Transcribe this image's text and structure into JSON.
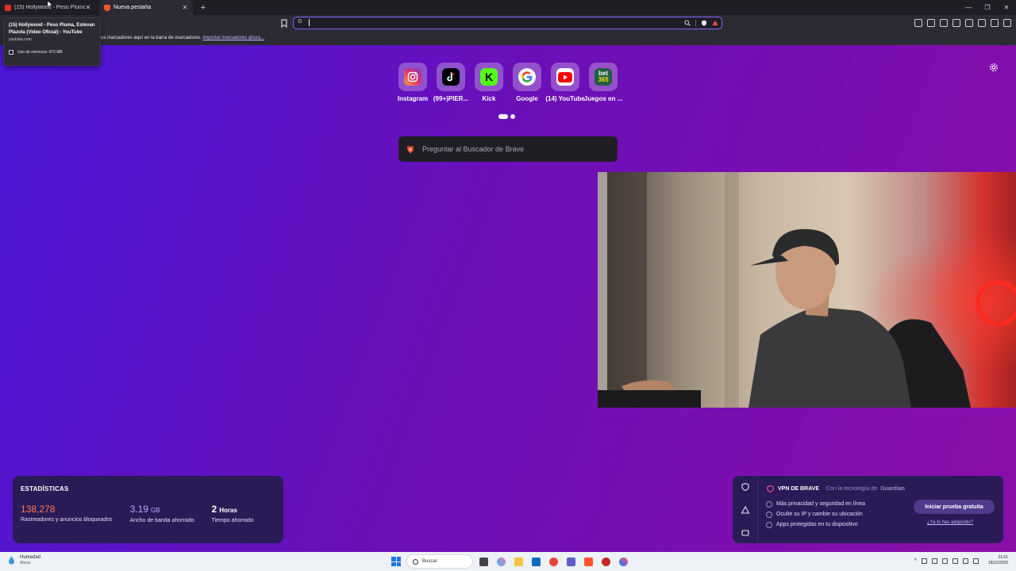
{
  "tabs": [
    {
      "title": "(15) Hollywood - Peso Pluma, Es",
      "favicon": "youtube-icon",
      "active": false
    },
    {
      "title": "Nueva pestaña",
      "favicon": "brave-icon",
      "active": true
    }
  ],
  "tooltip": {
    "title": "(15) Hollywood - Peso Pluma, Estevan Plazola (Video Oficial) - YouTube",
    "domain": "youtube.com",
    "memory": "Uso de memoria: 473 MB"
  },
  "address_bar": {
    "value": "",
    "engine_icon": "google-icon"
  },
  "bookmarks_bar": {
    "text": "us marcadores aquí en la barra de marcadores.",
    "link": "Importar marcadores ahora..."
  },
  "top_sites": [
    {
      "label": "Instagram",
      "icon": "instagram-icon",
      "color": "#e1306c"
    },
    {
      "label": "(99+)PIER...",
      "icon": "tiktok-icon",
      "color": "#000000"
    },
    {
      "label": "Kick",
      "icon": "kick-icon",
      "color": "#53fc18"
    },
    {
      "label": "Google",
      "icon": "google-icon",
      "color": "#ffffff"
    },
    {
      "label": "(14) YouTube",
      "icon": "youtube-icon",
      "color": "#ff0000"
    },
    {
      "label": "Juegos en ...",
      "icon": "bet365-icon",
      "color": "#1f5f3f"
    }
  ],
  "search": {
    "placeholder": "Preguntar al Buscador de Brave"
  },
  "stats": {
    "title": "ESTADÍSTICAS",
    "items": [
      {
        "value": "138,278",
        "unit": "",
        "label": "Rastreadores y anuncios bloqueados",
        "color": "#ff7a59"
      },
      {
        "value": "3.19",
        "unit": "GB",
        "label": "Ancho de banda ahorrado",
        "color": "#b9a6ff"
      },
      {
        "value": "2",
        "unit": "Horas",
        "label": "Tiempo ahorrado",
        "color": "#ffffff"
      }
    ]
  },
  "vpn": {
    "title": "VPN DE BRAVE",
    "powered": "Con la tecnología de",
    "partner": "Guardian",
    "features": [
      "Más privacidad y seguridad en línea",
      "Oculte su IP y cambie su ubicación",
      "Apps protegidas en tu dispositivo"
    ],
    "cta": "Iniciar prueba gratuita",
    "link": "¿Ya lo has adquirido?"
  },
  "taskbar": {
    "weather_title": "Humedad",
    "weather_sub": "Ahora",
    "search_label": "Buscar",
    "time": "21:01",
    "date": "18/12/2025"
  },
  "colors": {
    "accent": "#8a63ff",
    "brave": "#fb542b"
  }
}
